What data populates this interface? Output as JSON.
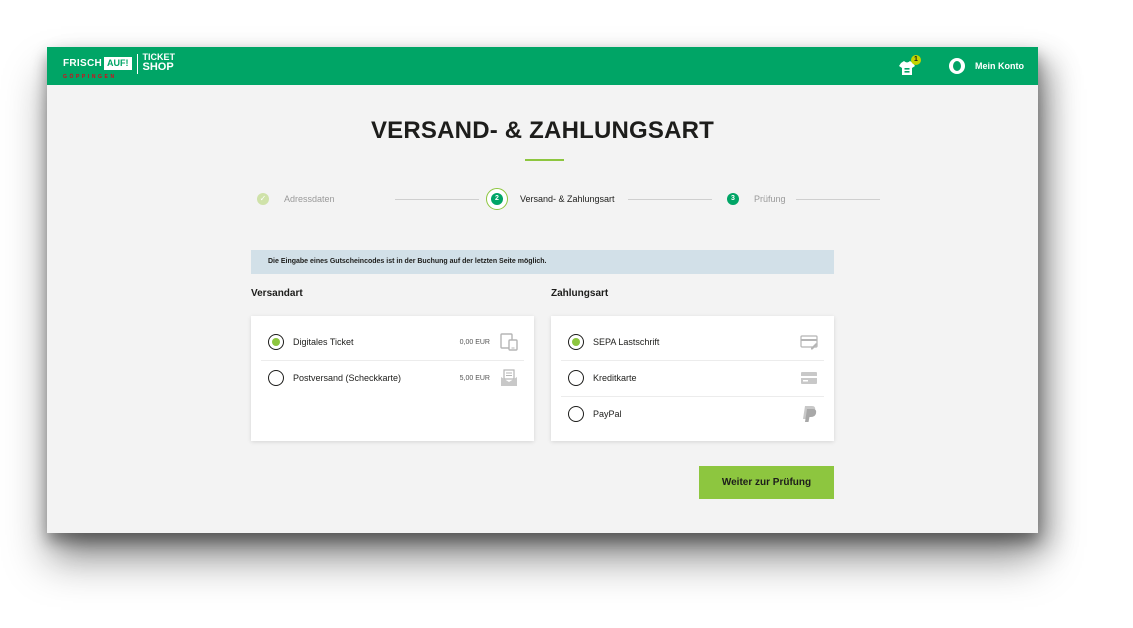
{
  "header": {
    "logo_frisch": "FRISCH",
    "logo_auf": "AUF!",
    "logo_city": "GÖPPINGEN",
    "logo_ticket": "TICKET",
    "logo_shop": "SHOP",
    "cart_badge": "1",
    "account_label": "Mein Konto"
  },
  "page": {
    "title": "VERSAND- & ZAHLUNGSART"
  },
  "steps": [
    {
      "num": "✓",
      "label": "Adressdaten",
      "state": "done"
    },
    {
      "num": "2",
      "label": "Versand- & Zahlungsart",
      "state": "active"
    },
    {
      "num": "3",
      "label": "Prüfung",
      "state": "pending"
    }
  ],
  "info": "Die Eingabe eines Gutscheincodes ist in der Buchung auf der letzten Seite möglich.",
  "versandart": {
    "heading": "Versandart",
    "options": [
      {
        "label": "Digitales Ticket",
        "price": "0,00 EUR",
        "icon": "mobile-ticket-icon",
        "selected": true
      },
      {
        "label": "Postversand (Scheckkarte)",
        "price": "5,00 EUR",
        "icon": "mail-envelope-icon",
        "selected": false
      }
    ]
  },
  "zahlungsart": {
    "heading": "Zahlungsart",
    "options": [
      {
        "label": "SEPA Lastschrift",
        "icon": "sepa-card-icon",
        "selected": true
      },
      {
        "label": "Kreditkarte",
        "icon": "credit-card-icon",
        "selected": false
      },
      {
        "label": "PayPal",
        "icon": "paypal-icon",
        "selected": false
      }
    ]
  },
  "submit_label": "Weiter zur Prüfung",
  "colors": {
    "brand_green": "#00a566",
    "accent_lime": "#8dc63f",
    "info_bg": "#d2e0e8"
  }
}
